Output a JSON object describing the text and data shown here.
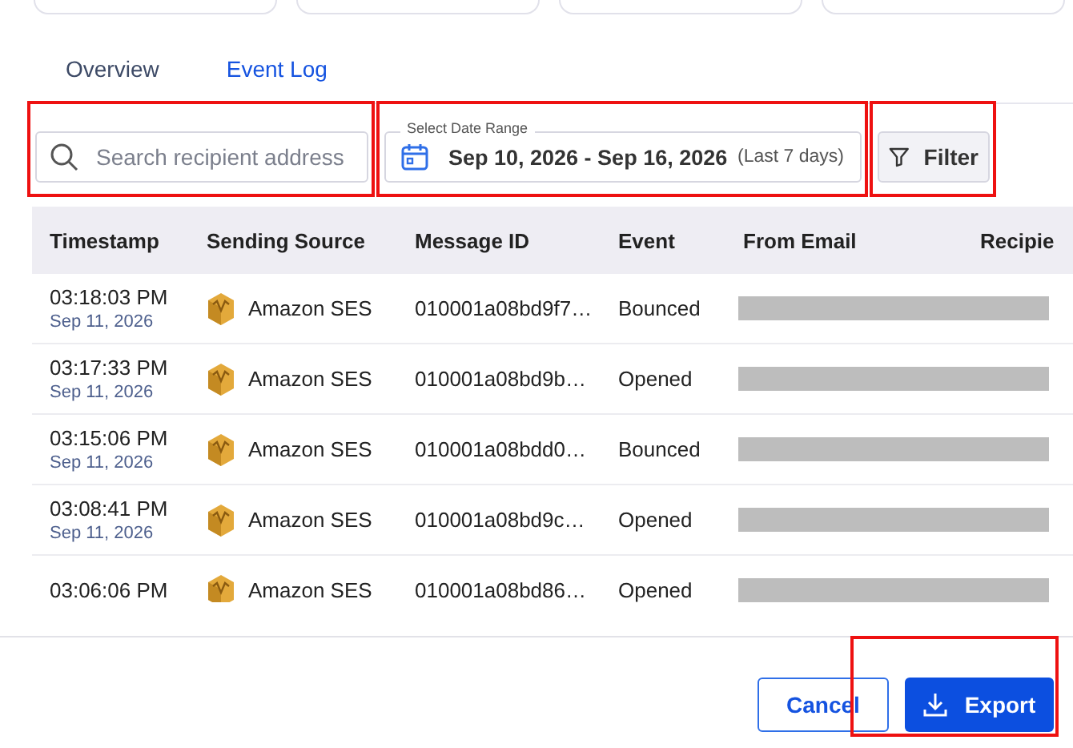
{
  "tabs": [
    {
      "label": "Overview",
      "selected": false
    },
    {
      "label": "Event Log",
      "selected": true
    }
  ],
  "search": {
    "placeholder": "Search recipient address",
    "highlighted": true
  },
  "date_range": {
    "label": "Select Date Range",
    "value": "Sep 10, 2026 - Sep 16, 2026",
    "hint": "(Last 7 days)",
    "highlighted": true
  },
  "filter_button": {
    "label": "Filter",
    "highlighted": true
  },
  "table": {
    "columns": [
      "Timestamp",
      "Sending Source",
      "Message ID",
      "Event",
      "From Email",
      "Recipie"
    ],
    "rows": [
      {
        "time": "03:18:03 PM",
        "date": "Sep 11, 2026",
        "source": "Amazon SES",
        "message_id": "010001a08bd9f7…",
        "event": "Bounced",
        "from_email_redacted": true
      },
      {
        "time": "03:17:33 PM",
        "date": "Sep 11, 2026",
        "source": "Amazon SES",
        "message_id": "010001a08bd9b…",
        "event": "Opened",
        "from_email_redacted": true
      },
      {
        "time": "03:15:06 PM",
        "date": "Sep 11, 2026",
        "source": "Amazon SES",
        "message_id": "010001a08bdd0…",
        "event": "Bounced",
        "from_email_redacted": true
      },
      {
        "time": "03:08:41 PM",
        "date": "Sep 11, 2026",
        "source": "Amazon SES",
        "message_id": "010001a08bd9c…",
        "event": "Opened",
        "from_email_redacted": true
      },
      {
        "time": "03:06:06 PM",
        "source": "Amazon SES",
        "message_id": "010001a08bd86…",
        "event": "Opened",
        "from_email_redacted": true
      }
    ]
  },
  "footer": {
    "cancel": {
      "label": "Cancel"
    },
    "export": {
      "label": "Export",
      "highlighted": true
    }
  }
}
